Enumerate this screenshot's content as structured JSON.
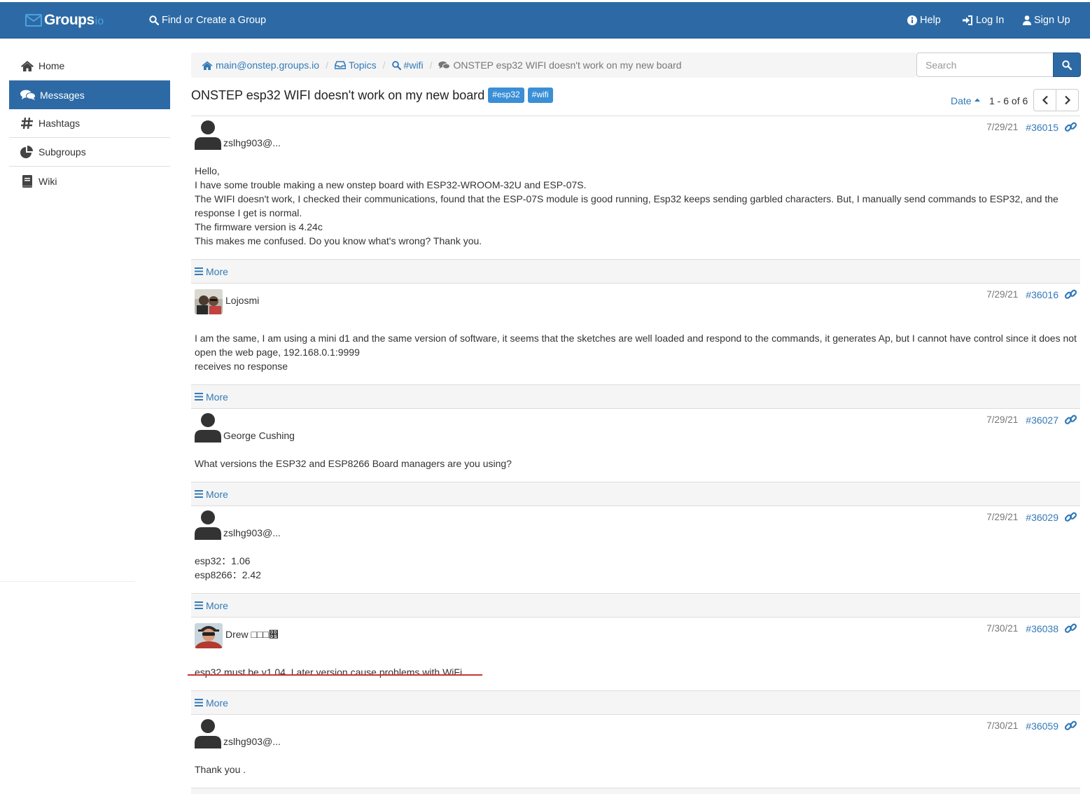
{
  "navbar": {
    "brand_word": "Groups",
    "brand_io": "io",
    "find_label": "Find or Create a Group",
    "help_label": "Help",
    "login_label": "Log In",
    "signup_label": "Sign Up"
  },
  "sidebar": {
    "items": [
      {
        "label": "Home"
      },
      {
        "label": "Messages"
      },
      {
        "label": "Hashtags"
      },
      {
        "label": "Subgroups"
      },
      {
        "label": "Wiki"
      }
    ]
  },
  "breadcrumb": {
    "group": "main@onstep.groups.io",
    "topics": "Topics",
    "hashtag": "#wifi",
    "current": "ONSTEP esp32 WIFI doesn't work on my new board"
  },
  "search": {
    "placeholder": "Search"
  },
  "topic": {
    "title": "ONSTEP esp32 WIFI doesn't work on my new board",
    "tags": [
      "#esp32",
      "#wifi"
    ]
  },
  "paging": {
    "sort_label": "Date",
    "count": "1 - 6 of 6"
  },
  "more_label": "More",
  "messages": [
    {
      "author": "zslhg903@...",
      "date": "7/29/21",
      "number": "#36015",
      "body": [
        "Hello,",
        "I have some trouble making a new onstep board with ESP32-WROOM-32U and ESP-07S.",
        "The WIFI doesn't work, I checked their communications, found that the ESP-07S module is good running, Esp32 keeps sending garbled characters. But, I manually send commands to ESP32, and the response I get is normal.",
        "The firmware version is 4.24c",
        "This makes me confused. Do you know what's wrong? Thank you."
      ]
    },
    {
      "author": "Lojosmi",
      "date": "7/29/21",
      "number": "#36016",
      "body": [
        "I am the same, I am using a mini d1 and the same version of software, it seems that the sketches are well loaded and respond to the commands, it generates Ap, but I cannot have control since it does not open the web page, 192.168.0.1:9999",
        "receives no response"
      ]
    },
    {
      "author": "George Cushing",
      "date": "7/29/21",
      "number": "#36027",
      "body": [
        "What versions the ESP32 and ESP8266 Board managers are you using?"
      ]
    },
    {
      "author": "zslhg903@...",
      "date": "7/29/21",
      "number": "#36029",
      "body": [
        "esp32：1.06",
        "esp8266：2.42"
      ]
    },
    {
      "author": "Drew □□□෕",
      "date": "7/30/21",
      "number": "#36038",
      "body": [
        "esp32 must be v1.04. Later version cause problems with WiFi."
      ]
    },
    {
      "author": "zslhg903@...",
      "date": "7/30/21",
      "number": "#36059",
      "body": [
        "Thank you ."
      ]
    }
  ],
  "colors": {
    "navbar": "#2d6aa5",
    "link": "#337ab7",
    "tag": "#3a8fd6",
    "underline": "#cc3333"
  }
}
